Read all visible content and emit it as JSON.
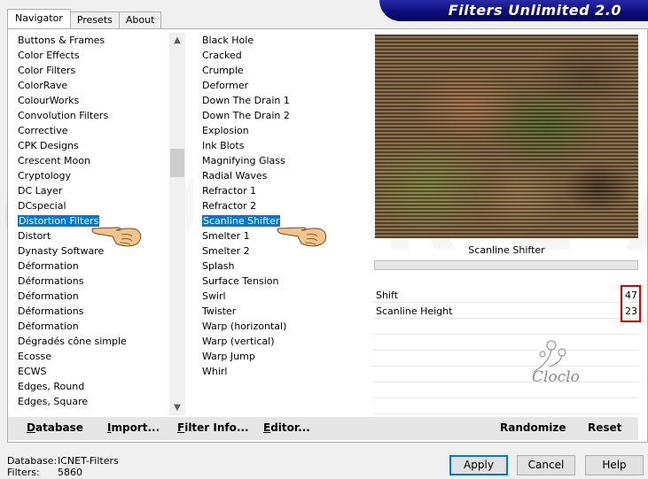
{
  "window": {
    "title": "Filters Unlimited 2.0",
    "tabs": [
      {
        "label": "Navigator"
      },
      {
        "label": "Presets"
      },
      {
        "label": "About"
      }
    ]
  },
  "categories": {
    "items": [
      "Buttons & Frames",
      "Color Effects",
      "Color Filters",
      "ColorRave",
      "ColourWorks",
      "Convolution Filters",
      "Corrective",
      "CPK Designs",
      "Crescent Moon",
      "Cryptology",
      "DC Layer",
      "DCspecial",
      "Distortion Filters",
      "Distort",
      "Dynasty Software",
      "Déformation",
      "Déformations",
      "Déformation",
      "Déformations",
      "Déformation",
      "Dégradés cône simple",
      "Ecosse",
      "ECWS",
      "Edges, Round",
      "Edges, Square"
    ],
    "selected": "Distortion Filters"
  },
  "filters": {
    "items": [
      "Black Hole",
      "Cracked",
      "Crumple",
      "Deformer",
      "Down The Drain 1",
      "Down The Drain 2",
      "Explosion",
      "Ink Blots",
      "Magnifying Glass",
      "Radial Waves",
      "Refractor 1",
      "Refractor 2",
      "Scanline Shifter",
      "Smelter 1",
      "Smelter 2",
      "Splash",
      "Surface Tension",
      "Swirl",
      "Twister",
      "Warp (horizontal)",
      "Warp (vertical)",
      "Warp Jump",
      "Whirl"
    ],
    "selected": "Scanline Shifter"
  },
  "preview": {
    "caption": "Scanline Shifter",
    "progress": 0
  },
  "params": [
    {
      "label": "Shift",
      "value": "47"
    },
    {
      "label": "Scanline Height",
      "value": "23"
    }
  ],
  "logo": {
    "text": "Cloclo"
  },
  "watermark": {
    "text": "OVERLAY"
  },
  "toolbar": {
    "database": {
      "u": "D",
      "rest": "atabase"
    },
    "import": {
      "u": "I",
      "rest": "mport..."
    },
    "filter_info": {
      "u": "F",
      "rest": "ilter Info..."
    },
    "editor": {
      "u": "E",
      "rest": "ditor..."
    },
    "randomize": "Randomize",
    "reset": "Reset"
  },
  "status": {
    "database_label": "Database:",
    "database_value": "ICNET-Filters",
    "filters_label": "Filters:",
    "filters_value": "5860"
  },
  "buttons": {
    "apply": "Apply",
    "cancel": "Cancel",
    "help": "Help"
  },
  "colors": {
    "accent": "#0078d7",
    "header": "#0d0d7a",
    "highlight_frame": "#e00000"
  }
}
